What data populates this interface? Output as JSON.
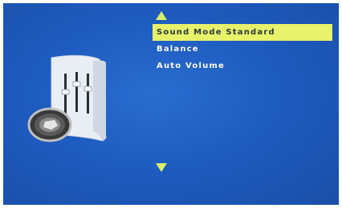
{
  "osd": {
    "icon": "sound-settings-icon",
    "menu": [
      {
        "label": "Sound Mode Standard",
        "selected": true
      },
      {
        "label": "Balance",
        "selected": false
      },
      {
        "label": "Auto Volume",
        "selected": false
      }
    ],
    "colors": {
      "background": "#1e5cc0",
      "highlight": "#e8f26a",
      "arrow": "#d8f06a",
      "text": "#ffffff"
    }
  }
}
